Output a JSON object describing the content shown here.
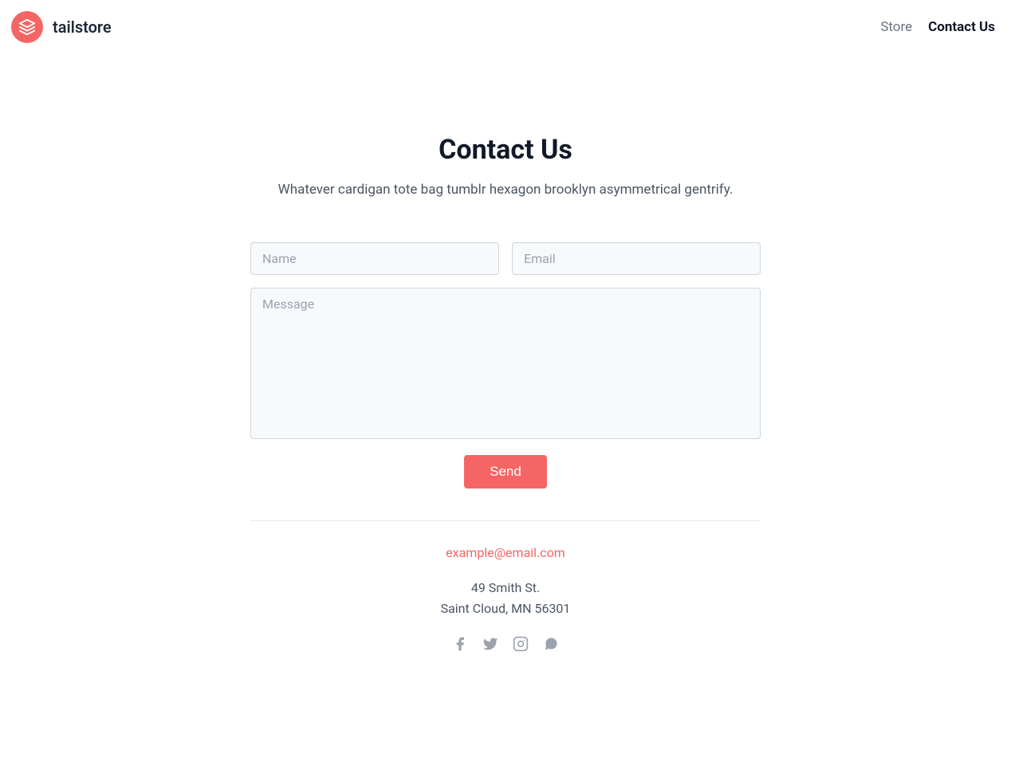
{
  "brand": {
    "name": "tailstore"
  },
  "nav": {
    "store": "Store",
    "contact": "Contact Us"
  },
  "page": {
    "title": "Contact Us",
    "subtitle": "Whatever cardigan tote bag tumblr hexagon brooklyn asymmetrical gentrify."
  },
  "form": {
    "name_placeholder": "Name",
    "email_placeholder": "Email",
    "message_placeholder": "Message",
    "send_label": "Send"
  },
  "contact": {
    "email": "example@email.com",
    "address_line1": "49 Smith St.",
    "address_line2": "Saint Cloud, MN 56301"
  }
}
